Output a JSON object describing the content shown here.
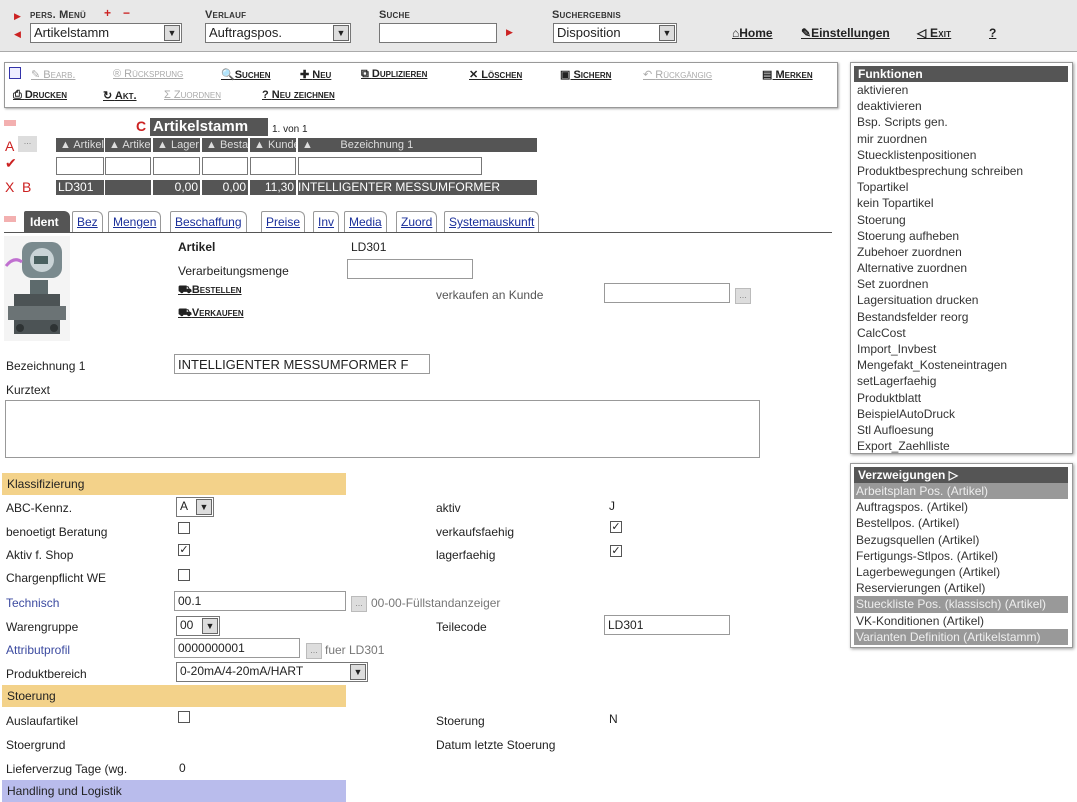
{
  "topbar": {
    "pers_menu_label": "pers. Menü",
    "plus": "+",
    "minus": "−",
    "pers_menu_value": "Artikelstamm",
    "verlauf_label": "Verlauf",
    "verlauf_value": "Auftragspos.",
    "suche_label": "Suche",
    "suche_value": "",
    "suchergebnis_label": "Suchergebnis",
    "suchergebnis_value": "Disposition",
    "home": "Home",
    "einstellungen": "Einstellungen",
    "exit": "Exit",
    "help": "?"
  },
  "toolbar": {
    "bearb": "Bearb.",
    "ruecksprung": "Rücksprung",
    "suchen": "Suchen",
    "neu": "Neu",
    "duplizieren": "Duplizieren",
    "loeschen": "Löschen",
    "sichern": "Sichern",
    "rueckgaengig": "Rückgängig",
    "merken": "Merken",
    "drucken": "Drucken",
    "akt": "Akt.",
    "zuordnen": "Zuordnen",
    "neu_zeichnen": "Neu zeichnen"
  },
  "grid": {
    "title_prefix": "C",
    "title": "Artikelstamm",
    "count": "1. von 1",
    "row_a": "A",
    "row_a_dots": "...",
    "row_x": "X",
    "row_b": "B",
    "headers": [
      "Artikel",
      "Artikel",
      "Lager",
      "Bestand",
      "Kunde",
      "Bezeichnung 1"
    ],
    "data": [
      "LD301",
      "",
      "0,00",
      "0,00",
      "11,30",
      "INTELLIGENTER MESSUMFORMER"
    ]
  },
  "tabs": [
    "Ident",
    "Bez",
    "Mengen",
    "Beschaffung",
    "Preise",
    "Inv",
    "Media",
    "Zuord",
    "Systemauskunft"
  ],
  "ident": {
    "artikel_label": "Artikel",
    "artikel_value": "LD301",
    "verarbeitungsmenge_label": "Verarbeitungsmenge",
    "verarbeitungsmenge_value": "",
    "bestellen": "Bestellen",
    "verkaufen": "Verkaufen",
    "verkaufen_an_kunde_label": "verkaufen an Kunde",
    "verkaufen_an_kunde_value": "",
    "bezeichnung1_label": "Bezeichnung 1",
    "bezeichnung1_value": "INTELLIGENTER MESSUMFORMER F",
    "kurztext_label": "Kurztext",
    "kurztext_value": ""
  },
  "klassifizierung": {
    "title": "Klassifizierung",
    "abc_label": "ABC-Kennz.",
    "abc_value": "A",
    "aktiv_label": "aktiv",
    "aktiv_value": "J",
    "beratung_label": "benoetigt Beratung",
    "verkaufsfaehig_label": "verkaufsfaehig",
    "shop_label": "Aktiv f. Shop",
    "lagerfaehig_label": "lagerfaehig",
    "charge_label": "Chargenpflicht WE",
    "technisch_label": "Technisch",
    "technisch_value": "00.1",
    "technisch_desc": "00-00-Füllstandanzeiger",
    "warengruppe_label": "Warengruppe",
    "warengruppe_value": "00",
    "teilecode_label": "Teilecode",
    "teilecode_value": "LD301",
    "attributprofil_label": "Attributprofil",
    "attributprofil_value": "0000000001",
    "attributprofil_desc": "fuer LD301",
    "produktbereich_label": "Produktbereich",
    "produktbereich_value": "0-20mA/4-20mA/HART"
  },
  "stoerung": {
    "title": "Stoerung",
    "auslauf_label": "Auslaufartikel",
    "stoerung_label": "Stoerung",
    "stoerung_value": "N",
    "stoergrund_label": "Stoergrund",
    "datum_label": "Datum letzte Stoerung",
    "lieferverzug_label": "Lieferverzug Tage (wg.",
    "lieferverzug_value": "0"
  },
  "handling": {
    "title": "Handling und Logistik"
  },
  "funktionen": {
    "title": "Funktionen",
    "items": [
      "aktivieren",
      "deaktivieren",
      "Bsp. Scripts gen.",
      "mir zuordnen",
      "Stuecklistenpositionen",
      "Produktbesprechung schreiben",
      "Topartikel",
      "kein Topartikel",
      "Stoerung",
      "Stoerung aufheben",
      "Zubehoer zuordnen",
      "Alternative zuordnen",
      "Set zuordnen",
      "Lagersituation drucken",
      "Bestandsfelder reorg",
      "CalcCost",
      "Import_Invbest",
      "Mengefakt_Kosteneintragen",
      "setLagerfaehig",
      "Produktblatt",
      "BeispielAutoDruck",
      "Stl Aufloesung",
      "Export_Zaehlliste"
    ]
  },
  "verzweigungen": {
    "title": "Verzweigungen",
    "items": [
      "Arbeitsplan Pos. (Artikel)",
      "Auftragspos. (Artikel)",
      "Bestellpos. (Artikel)",
      "Bezugsquellen (Artikel)",
      "Fertigungs-Stlpos. (Artikel)",
      "Lagerbewegungen (Artikel)",
      "Reservierungen (Artikel)",
      "Stueckliste Pos. (klassisch) (Artikel)",
      "VK-Konditionen (Artikel)",
      "Varianten Definition (Artikelstamm)"
    ]
  },
  "colors": {
    "section_yellow": "#f3d28a",
    "section_blue": "#b9bcec",
    "red": "#cc2222"
  }
}
